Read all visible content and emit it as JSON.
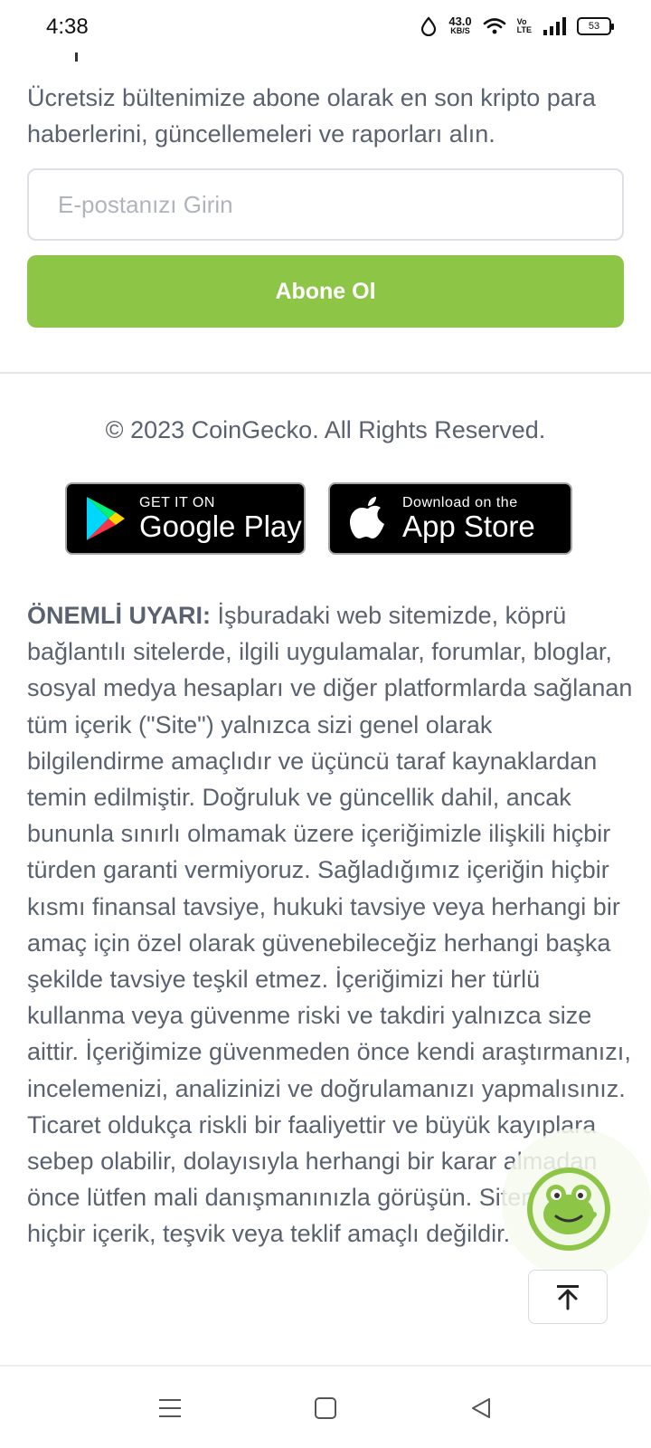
{
  "status_bar": {
    "time": "4:38",
    "net_speed_value": "43.0",
    "net_speed_unit": "KB/S",
    "volte_top": "Vo",
    "volte_bottom": "LTE",
    "battery": "53"
  },
  "newsletter": {
    "description": "Ücretsiz bültenimize abone olarak en son kripto para haberlerini, güncellemeleri ve raporları alın.",
    "email_placeholder": "E-postanızı Girin",
    "subscribe_label": "Abone Ol"
  },
  "footer": {
    "copyright": "© 2023 CoinGecko. All Rights Reserved.",
    "google_play_small": "GET IT ON",
    "google_play_large": "Google Play",
    "app_store_small": "Download on the",
    "app_store_large": "App Store"
  },
  "disclaimer": {
    "label": "ÖNEMLİ UYARI:",
    "text": "İşburadaki web sitemizde, köprü bağlantılı sitelerde, ilgili uygulamalar, forumlar, bloglar, sosyal medya hesapları ve diğer platformlarda sağlanan tüm içerik (\"Site\") yalnızca sizi genel olarak bilgilendirme amaçlıdır ve üçüncü taraf kaynaklardan temin edilmiştir. Doğruluk ve güncellik dahil, ancak bununla sınırlı olmamak üzere içeriğimizle ilişkili hiçbir türden garanti vermiyoruz. Sağladığımız içeriğin hiçbir kısmı finansal tavsiye, hukuki tavsiye veya herhangi bir amaç için özel olarak güvenebileceğiz herhangi başka şekilde tavsiye teşkil etmez. İçeriğimizi her türlü kullanma veya güvenme riski ve takdiri yalnızca size aittir. İçeriğimize güvenmeden önce kendi araştırmanızı, incelemenizi, analizinizi ve doğrulamanızı yapmalısınız. Ticaret oldukça riskli bir faaliyettir ve büyük kayıplara sebep olabilir, dolayısıyla herhangi bir karar almadan önce lütfen mali danışmanınızla görüşün. Sitemizdeki hiçbir içerik, teşvik veya teklif amaçlı değildir."
  },
  "colors": {
    "accent_green": "#8dc647",
    "text_gray": "#5a6270",
    "border_gray": "#dcdfe4"
  },
  "icons": {
    "mascot": "coingecko-gecko-icon",
    "back_to_top": "arrow-up-icon",
    "google_play": "google-play-icon",
    "apple": "apple-icon",
    "nav_menu": "menu-icon",
    "nav_home": "home-square-icon",
    "nav_back": "back-triangle-icon"
  }
}
